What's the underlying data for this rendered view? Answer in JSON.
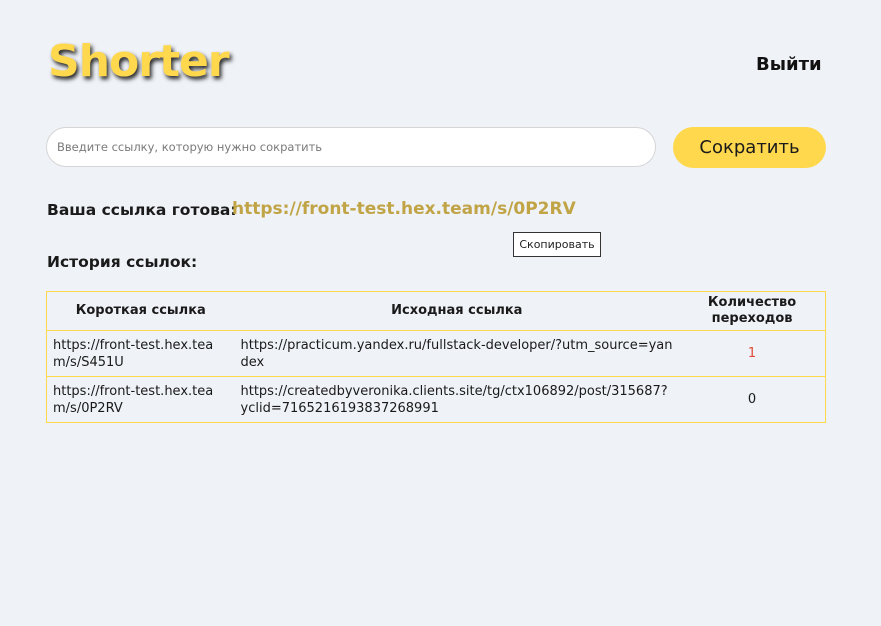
{
  "header": {
    "logo": "Shorter",
    "logout_label": "Выйти"
  },
  "form": {
    "placeholder": "Введите ссылку, которую нужно сократить",
    "value": "",
    "submit_label": "Сократить"
  },
  "result": {
    "label": "Ваша ссылка готова:",
    "link": "https://front-test.hex.team/s/0P2RV",
    "copy_tooltip": "Скопировать"
  },
  "history": {
    "title": "История ссылок:",
    "columns": [
      "Короткая ссылка",
      "Исходная ссылка",
      "Количество переходов"
    ],
    "rows": [
      {
        "short": "https://front-test.hex.team/s/S451U",
        "original": "https://practicum.yandex.ru/fullstack-developer/?utm_source=yandex",
        "count": "1",
        "count_color": "#e04a3a"
      },
      {
        "short": "https://front-test.hex.team/s/0P2RV",
        "original": "https://createdbyveronika.clients.site/tg/ctx106892/post/315687?yclid=7165216193837268991",
        "count": "0",
        "count_color": "#1a1a1a"
      }
    ]
  },
  "colors": {
    "accent": "#ffd84d",
    "link": "#c0a446",
    "background": "#eff2f7"
  }
}
